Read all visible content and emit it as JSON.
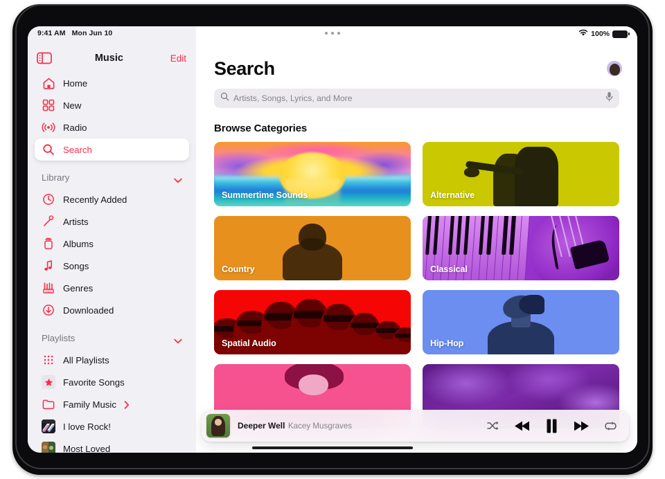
{
  "status_bar": {
    "time": "9:41 AM",
    "date": "Mon Jun 10",
    "wifi_icon": "wifi-icon",
    "battery_percent": "100%",
    "battery_icon": "battery-full-icon"
  },
  "sidebar": {
    "toggle_icon": "sidebar-toggle-icon",
    "title": "Music",
    "edit_label": "Edit",
    "nav_items": [
      {
        "label": "Home",
        "icon": "house-icon",
        "selected": false
      },
      {
        "label": "New",
        "icon": "grid-squares-icon",
        "selected": false
      },
      {
        "label": "Radio",
        "icon": "radio-waves-icon",
        "selected": false
      },
      {
        "label": "Search",
        "icon": "magnifier-icon",
        "selected": true
      }
    ],
    "library": {
      "header": "Library",
      "chevron_icon": "chevron-down-icon",
      "items": [
        {
          "label": "Recently Added",
          "icon": "clock-icon"
        },
        {
          "label": "Artists",
          "icon": "microphone-icon"
        },
        {
          "label": "Albums",
          "icon": "album-stack-icon"
        },
        {
          "label": "Songs",
          "icon": "music-note-icon"
        },
        {
          "label": "Genres",
          "icon": "genres-icon"
        },
        {
          "label": "Downloaded",
          "icon": "download-arrow-icon"
        }
      ]
    },
    "playlists": {
      "header": "Playlists",
      "chevron_icon": "chevron-down-icon",
      "items": [
        {
          "label": "All Playlists",
          "icon": "dot-grid-icon",
          "disclosure": false
        },
        {
          "label": "Favorite Songs",
          "icon": "star-icon",
          "disclosure": false
        },
        {
          "label": "Family Music",
          "icon": "folder-icon",
          "disclosure": true,
          "disclosure_icon": "chevron-right-icon"
        },
        {
          "label": "I love Rock!",
          "icon": "playlist-artwork",
          "disclosure": false
        },
        {
          "label": "Most Loved",
          "icon": "playlist-artwork",
          "disclosure": false
        }
      ]
    }
  },
  "main": {
    "page_title": "Search",
    "avatar_name": "user-avatar",
    "search": {
      "icon": "magnifier-icon",
      "placeholder": "Artists, Songs, Lyrics, and More",
      "value": "",
      "mic_icon": "microphone-icon"
    },
    "browse_title": "Browse Categories",
    "tiles": [
      {
        "label": "Summertime Sounds",
        "art": "sunset-ocean",
        "color": "#f59ad0"
      },
      {
        "label": "Alternative",
        "art": "two-figures-silhouette",
        "color": "#cac800"
      },
      {
        "label": "Country",
        "art": "bearded-man-portrait",
        "color": "#e8901e"
      },
      {
        "label": "Classical",
        "art": "piano-keys-and-violin",
        "color": "#9b2fd4"
      },
      {
        "label": "Spatial Audio",
        "art": "crowd-with-sunglasses",
        "color": "#f60505"
      },
      {
        "label": "Hip-Hop",
        "art": "female-artist-portrait",
        "color": "#6b8ef0"
      },
      {
        "label": "",
        "art": "woman-with-hat",
        "color": "#f6528f"
      },
      {
        "label": "",
        "art": "purple-clouds",
        "color": "#7b2aa8"
      }
    ]
  },
  "now_playing": {
    "artwork_name": "album-artwork",
    "title": "Deeper Well",
    "artist": "Kacey Musgraves",
    "controls": [
      {
        "name": "shuffle-button",
        "icon": "shuffle-icon"
      },
      {
        "name": "previous-button",
        "icon": "rewind-icon"
      },
      {
        "name": "play-pause-button",
        "icon": "pause-icon"
      },
      {
        "name": "next-button",
        "icon": "fast-forward-icon"
      },
      {
        "name": "repeat-button",
        "icon": "repeat-icon"
      }
    ]
  },
  "colors": {
    "accent": "#fa2d48",
    "sidebar_bg": "#f1f0f5",
    "text": "#16161a",
    "secondary_text": "#86858c"
  }
}
